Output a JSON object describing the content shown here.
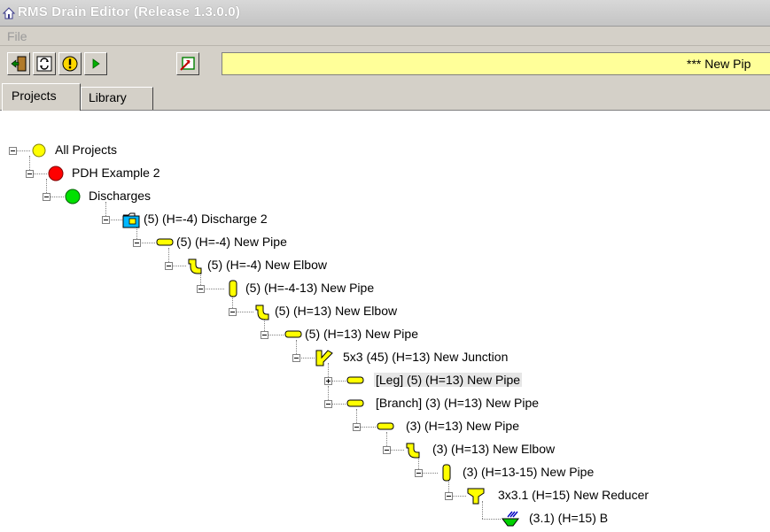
{
  "window": {
    "title": "RMS Drain Editor (Release 1.3.0.0)"
  },
  "menu": {
    "file": "File"
  },
  "toolbar": {
    "buttons": [
      {
        "icon": "exit-door-icon"
      },
      {
        "icon": "refresh-icon"
      },
      {
        "icon": "warning-icon"
      },
      {
        "icon": "play-icon"
      },
      {
        "icon": "export-icon"
      }
    ],
    "message": "*** New Pip"
  },
  "tabs": [
    {
      "label": "Projects",
      "active": true
    },
    {
      "label": "Library",
      "active": false
    }
  ],
  "tree": [
    {
      "label": "All Projects",
      "icon": "yellow-circle-icon"
    },
    {
      "label": "PDH Example 2",
      "icon": "red-circle-icon"
    },
    {
      "label": "Discharges",
      "icon": "green-circle-icon"
    },
    {
      "label": "(5) (H=-4) Discharge 2",
      "icon": "discharge-icon"
    },
    {
      "label": "(5) (H=-4) New Pipe",
      "icon": "horizontal-pipe-icon"
    },
    {
      "label": "(5) (H=-4) New Elbow",
      "icon": "elbow-icon"
    },
    {
      "label": "(5) (H=-4-13) New Pipe",
      "icon": "vertical-pipe-icon"
    },
    {
      "label": "(5) (H=13) New Elbow",
      "icon": "elbow-icon"
    },
    {
      "label": "(5) (H=13) New Pipe",
      "icon": "horizontal-pipe-icon"
    },
    {
      "label": "5x3 (45)  (H=13) New Junction",
      "icon": "junction-icon"
    },
    {
      "label": "[Leg] (5) (H=13) New Pipe",
      "icon": "horizontal-pipe-icon",
      "selected": true
    },
    {
      "label": "[Branch] (3) (H=13) New Pipe",
      "icon": "horizontal-pipe-icon"
    },
    {
      "label": "(3) (H=13) New Pipe",
      "icon": "horizontal-pipe-icon"
    },
    {
      "label": "(3) (H=13) New Elbow",
      "icon": "elbow-icon"
    },
    {
      "label": "(3) (H=13-15) New Pipe",
      "icon": "vertical-pipe-icon"
    },
    {
      "label": "3x3.1 (H=15) New Reducer",
      "icon": "reducer-icon"
    },
    {
      "label": "(3.1) (H=15) B",
      "icon": "drain-icon"
    }
  ]
}
